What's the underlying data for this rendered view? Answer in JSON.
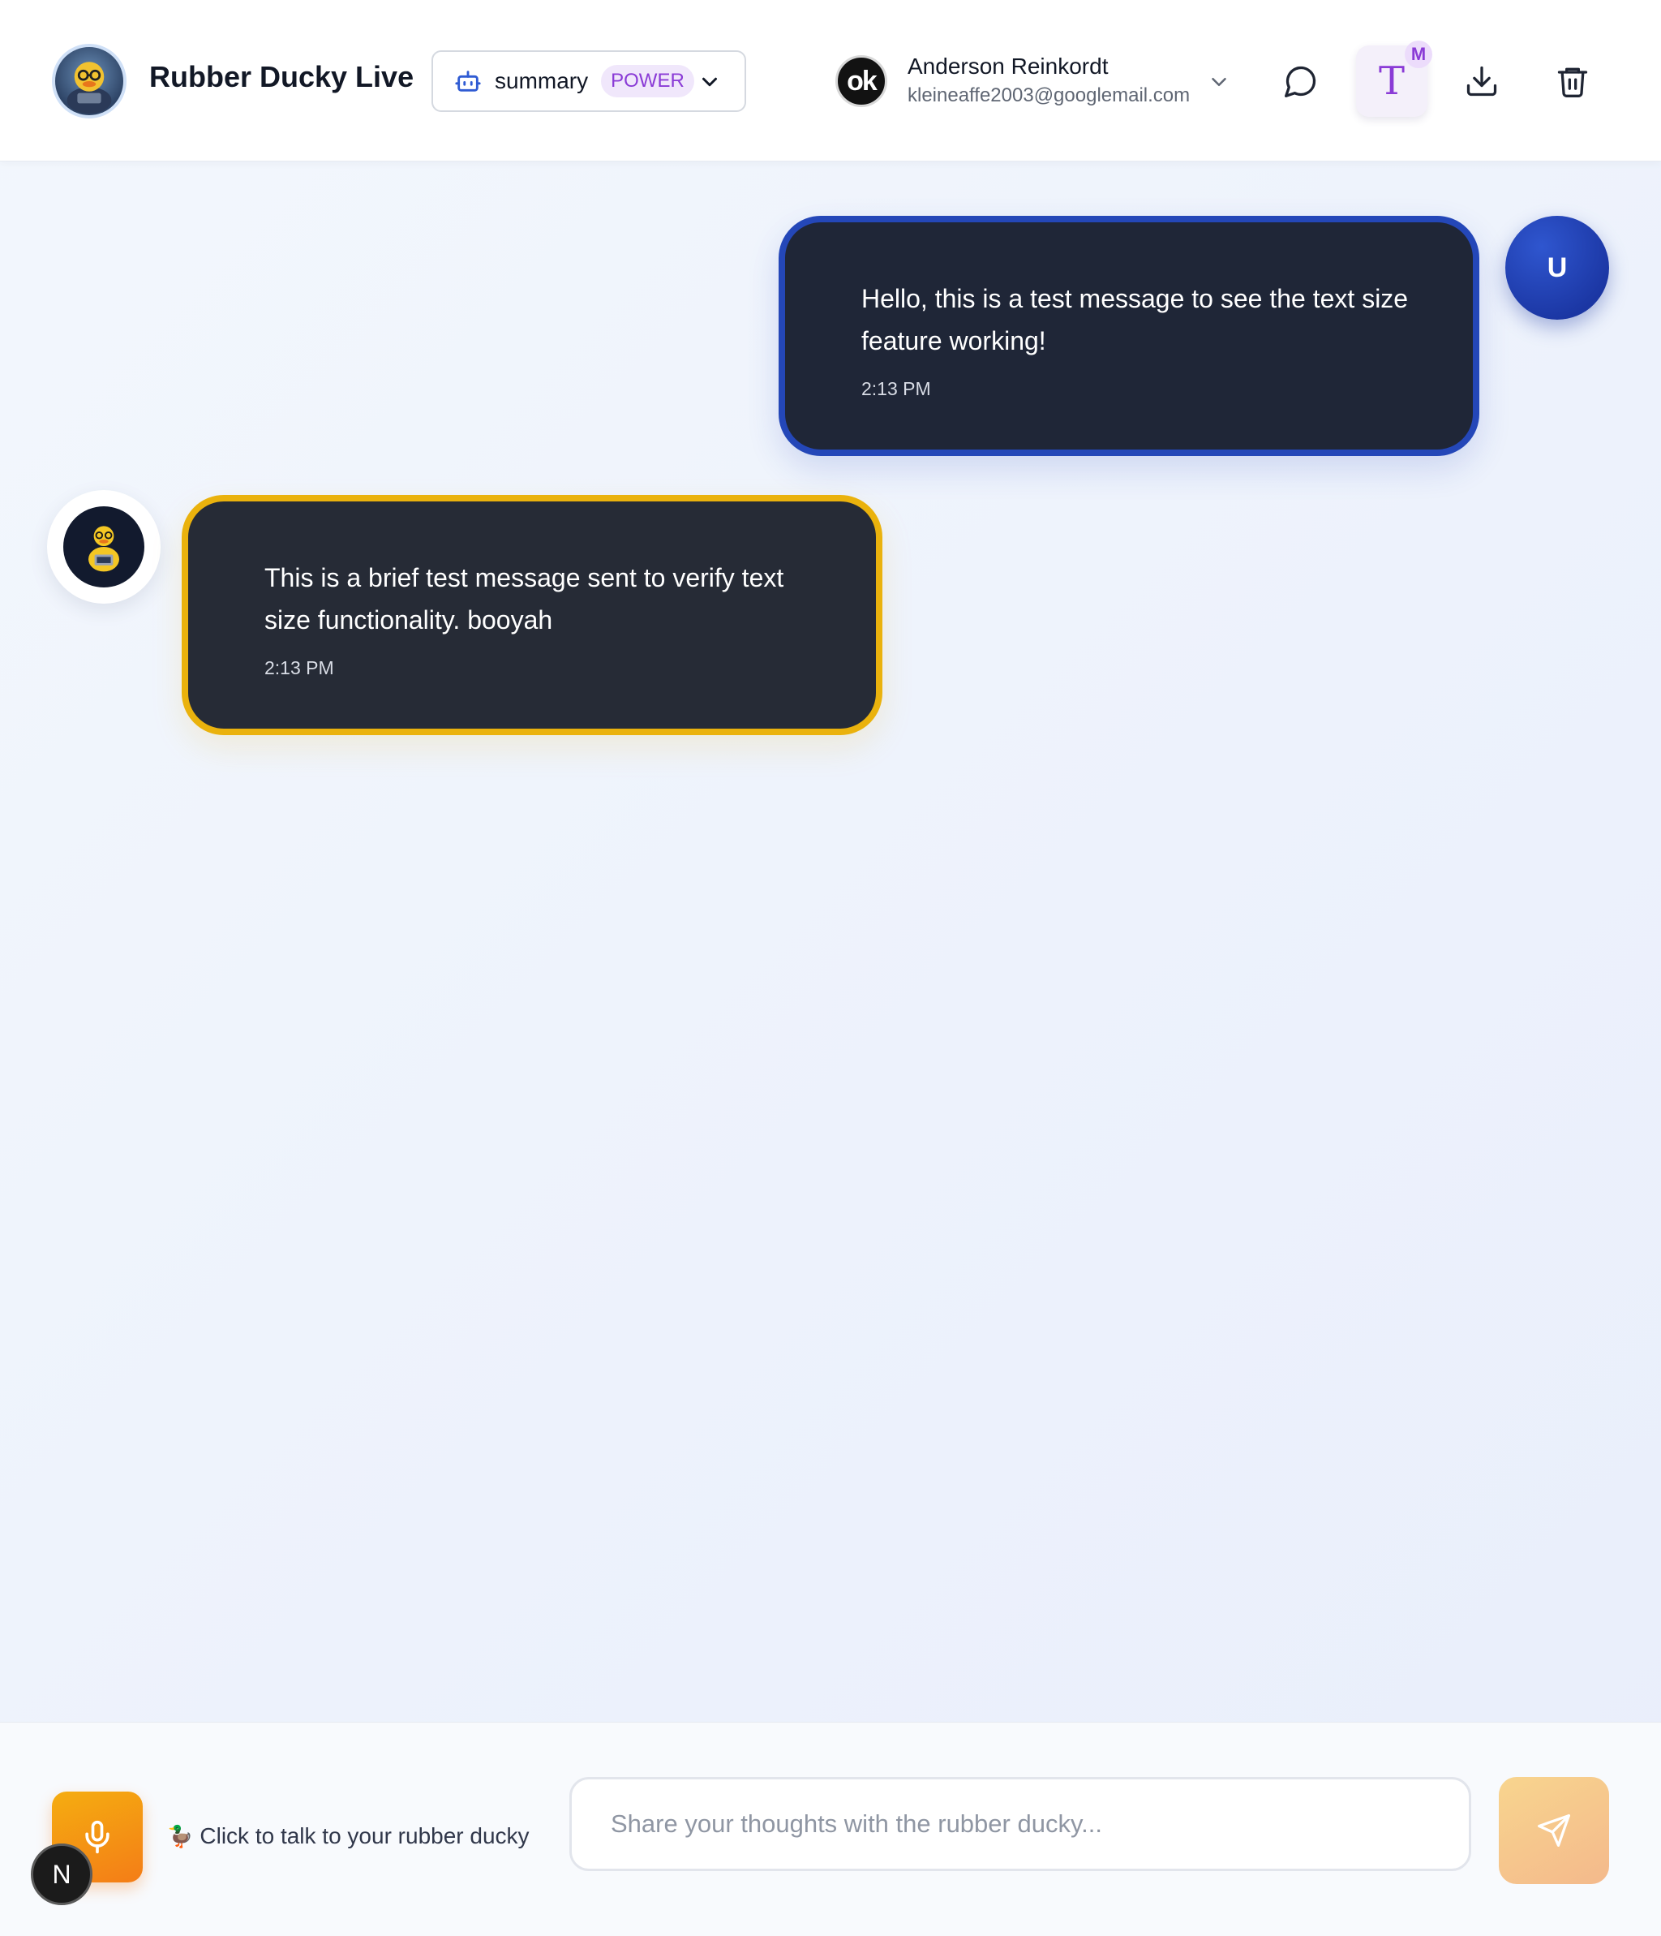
{
  "header": {
    "app_title": "Rubber Ducky Live",
    "model_selector": {
      "name": "summary",
      "badge": "POWER"
    },
    "user": {
      "name": "Anderson Reinkordt",
      "email": "kleineaffe2003@googlemail.com",
      "avatar_text": "ok"
    },
    "text_size_button": {
      "glyph": "T",
      "badge": "M"
    },
    "icons": [
      "chat-bubble-icon",
      "text-size-icon",
      "download-icon",
      "trash-icon"
    ]
  },
  "messages": [
    {
      "role": "user",
      "text": "Hello, this is a test message to see the text size feature working!",
      "time": "2:13 PM",
      "avatar_text": "U"
    },
    {
      "role": "assistant",
      "text": "This is a brief test message sent to verify text size functionality. booyah",
      "time": "2:13 PM"
    }
  ],
  "footer": {
    "voice_hint": "Click to talk to your rubber ducky",
    "voice_hint_icon": "🦆",
    "input_placeholder": "Share your thoughts with the rubber ducky...",
    "input_value": "",
    "corner_badge": "N"
  },
  "colors": {
    "user_bubble_border": "#2447b8",
    "bot_bubble_border": "#eab20d",
    "accent_purple": "#8a3bd6",
    "mic_orange": "#f47d17"
  }
}
